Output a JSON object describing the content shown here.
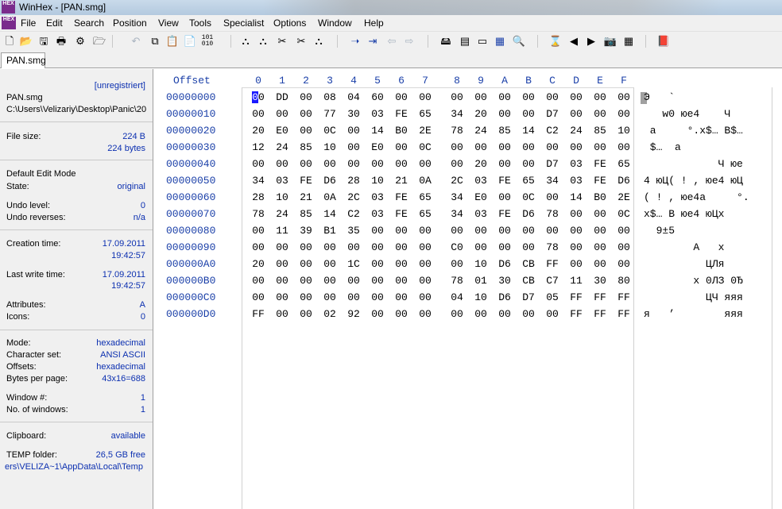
{
  "window": {
    "title": "WinHex - [PAN.smg]",
    "logo": "HEX"
  },
  "menu": [
    "File",
    "Edit",
    "Search",
    "Position",
    "View",
    "Tools",
    "Specialist",
    "Options",
    "Window",
    "Help"
  ],
  "tab": {
    "label": "PAN.smg"
  },
  "info": {
    "registration": "[unregistriert]",
    "file_name": "PAN.smg",
    "file_path": "C:\\Users\\Velizariy\\Desktop\\Panic\\20",
    "file_size_label": "File size:",
    "file_size_value": "224 B",
    "file_size_bytes": "224 bytes",
    "edit_mode": "Default Edit Mode",
    "state_label": "State:",
    "state_value": "original",
    "undo_level_label": "Undo level:",
    "undo_level_value": "0",
    "undo_reverses_label": "Undo reverses:",
    "undo_reverses_value": "n/a",
    "creation_label": "Creation time:",
    "creation_date": "17.09.2011",
    "creation_time": "19:42:57",
    "last_write_label": "Last write time:",
    "last_write_date": "17.09.2011",
    "last_write_time": "19:42:57",
    "attributes_label": "Attributes:",
    "attributes_value": "A",
    "icons_label": "Icons:",
    "icons_value": "0",
    "mode_label": "Mode:",
    "mode_value": "hexadecimal",
    "charset_label": "Character set:",
    "charset_value": "ANSI ASCII",
    "offsets_label": "Offsets:",
    "offsets_value": "hexadecimal",
    "bpp_label": "Bytes per page:",
    "bpp_value": "43x16=688",
    "window_no_label": "Window #:",
    "window_no_value": "1",
    "windows_count_label": "No. of windows:",
    "windows_count_value": "1",
    "clipboard_label": "Clipboard:",
    "clipboard_value": "available",
    "temp_label": "TEMP folder:",
    "temp_value": "26,5 GB free",
    "temp_path": "ers\\VELIZA~1\\AppData\\Local\\Temp"
  },
  "hex": {
    "offset_header": "Offset",
    "columns": [
      "0",
      "1",
      "2",
      "3",
      "4",
      "5",
      "6",
      "7",
      "8",
      "9",
      "A",
      "B",
      "C",
      "D",
      "E",
      "F"
    ],
    "rows": [
      {
        "offset": "00000000",
        "bytes": [
          "00",
          "DD",
          "00",
          "08",
          "04",
          "60",
          "00",
          "00",
          "00",
          "00",
          "00",
          "00",
          "00",
          "00",
          "00",
          "00"
        ],
        "text": "Э   `"
      },
      {
        "offset": "00000010",
        "bytes": [
          "00",
          "00",
          "00",
          "77",
          "30",
          "03",
          "FE",
          "65",
          "34",
          "20",
          "00",
          "00",
          "D7",
          "00",
          "00",
          "00"
        ],
        "text": "   w0 юе4    Ч"
      },
      {
        "offset": "00000020",
        "bytes": [
          "20",
          "E0",
          "00",
          "0C",
          "00",
          "14",
          "B0",
          "2E",
          "78",
          "24",
          "85",
          "14",
          "C2",
          "24",
          "85",
          "10"
        ],
        "text": " а     °.x$… В$…"
      },
      {
        "offset": "00000030",
        "bytes": [
          "12",
          "24",
          "85",
          "10",
          "00",
          "E0",
          "00",
          "0C",
          "00",
          "00",
          "00",
          "00",
          "00",
          "00",
          "00",
          "00"
        ],
        "text": " $…  а"
      },
      {
        "offset": "00000040",
        "bytes": [
          "00",
          "00",
          "00",
          "00",
          "00",
          "00",
          "00",
          "00",
          "00",
          "20",
          "00",
          "00",
          "D7",
          "03",
          "FE",
          "65"
        ],
        "text": "            Ч юе"
      },
      {
        "offset": "00000050",
        "bytes": [
          "34",
          "03",
          "FE",
          "D6",
          "28",
          "10",
          "21",
          "0A",
          "2C",
          "03",
          "FE",
          "65",
          "34",
          "03",
          "FE",
          "D6"
        ],
        "text": "4 юЦ( ! , юе4 юЦ"
      },
      {
        "offset": "00000060",
        "bytes": [
          "28",
          "10",
          "21",
          "0A",
          "2C",
          "03",
          "FE",
          "65",
          "34",
          "E0",
          "00",
          "0C",
          "00",
          "14",
          "B0",
          "2E"
        ],
        "text": "( ! , юе4а     °."
      },
      {
        "offset": "00000070",
        "bytes": [
          "78",
          "24",
          "85",
          "14",
          "C2",
          "03",
          "FE",
          "65",
          "34",
          "03",
          "FE",
          "D6",
          "78",
          "00",
          "00",
          "0C"
        ],
        "text": "x$… В юе4 юЦx"
      },
      {
        "offset": "00000080",
        "bytes": [
          "00",
          "11",
          "39",
          "B1",
          "35",
          "00",
          "00",
          "00",
          "00",
          "00",
          "00",
          "00",
          "00",
          "00",
          "00",
          "00"
        ],
        "text": "  9±5"
      },
      {
        "offset": "00000090",
        "bytes": [
          "00",
          "00",
          "00",
          "00",
          "00",
          "00",
          "00",
          "00",
          "C0",
          "00",
          "00",
          "00",
          "78",
          "00",
          "00",
          "00"
        ],
        "text": "        А   x"
      },
      {
        "offset": "000000A0",
        "bytes": [
          "20",
          "00",
          "00",
          "00",
          "1C",
          "00",
          "00",
          "00",
          "00",
          "10",
          "D6",
          "CB",
          "FF",
          "00",
          "00",
          "00"
        ],
        "text": "          ЦЛя"
      },
      {
        "offset": "000000B0",
        "bytes": [
          "00",
          "00",
          "00",
          "00",
          "00",
          "00",
          "00",
          "00",
          "78",
          "01",
          "30",
          "CB",
          "C7",
          "11",
          "30",
          "80"
        ],
        "text": "        x 0ЛЗ 0Ђ"
      },
      {
        "offset": "000000C0",
        "bytes": [
          "00",
          "00",
          "00",
          "00",
          "00",
          "00",
          "00",
          "00",
          "04",
          "10",
          "D6",
          "D7",
          "05",
          "FF",
          "FF",
          "FF"
        ],
        "text": "          ЦЧ яяя"
      },
      {
        "offset": "000000D0",
        "bytes": [
          "FF",
          "00",
          "00",
          "02",
          "92",
          "00",
          "00",
          "00",
          "00",
          "00",
          "00",
          "00",
          "00",
          "FF",
          "FF",
          "FF"
        ],
        "text": "я   ’        яяя"
      }
    ]
  },
  "colors": {
    "accent": "#1a3fa8",
    "cursor": "#1a1aff",
    "panel": "#f0f0f0"
  },
  "toolbar_icons": [
    "new-icon",
    "open-icon",
    "save-icon",
    "print-icon",
    "properties-icon",
    "open-folder-icon",
    "undo-icon",
    "copy-icon",
    "paste-icon",
    "clipboard-icon",
    "write-icon",
    "binary-icon",
    "find-icon",
    "find-hex-icon",
    "replace-icon",
    "replace-hex-icon",
    "find-next-icon",
    "goto-offset-icon",
    "goto-icon",
    "back-icon",
    "forward-icon",
    "disk-icon",
    "ram-icon",
    "cpu-icon",
    "calculator-icon",
    "zoom-icon",
    "tools-icon",
    "prev-icon",
    "next-icon",
    "camera-icon",
    "grid-icon",
    "help-book-icon"
  ]
}
